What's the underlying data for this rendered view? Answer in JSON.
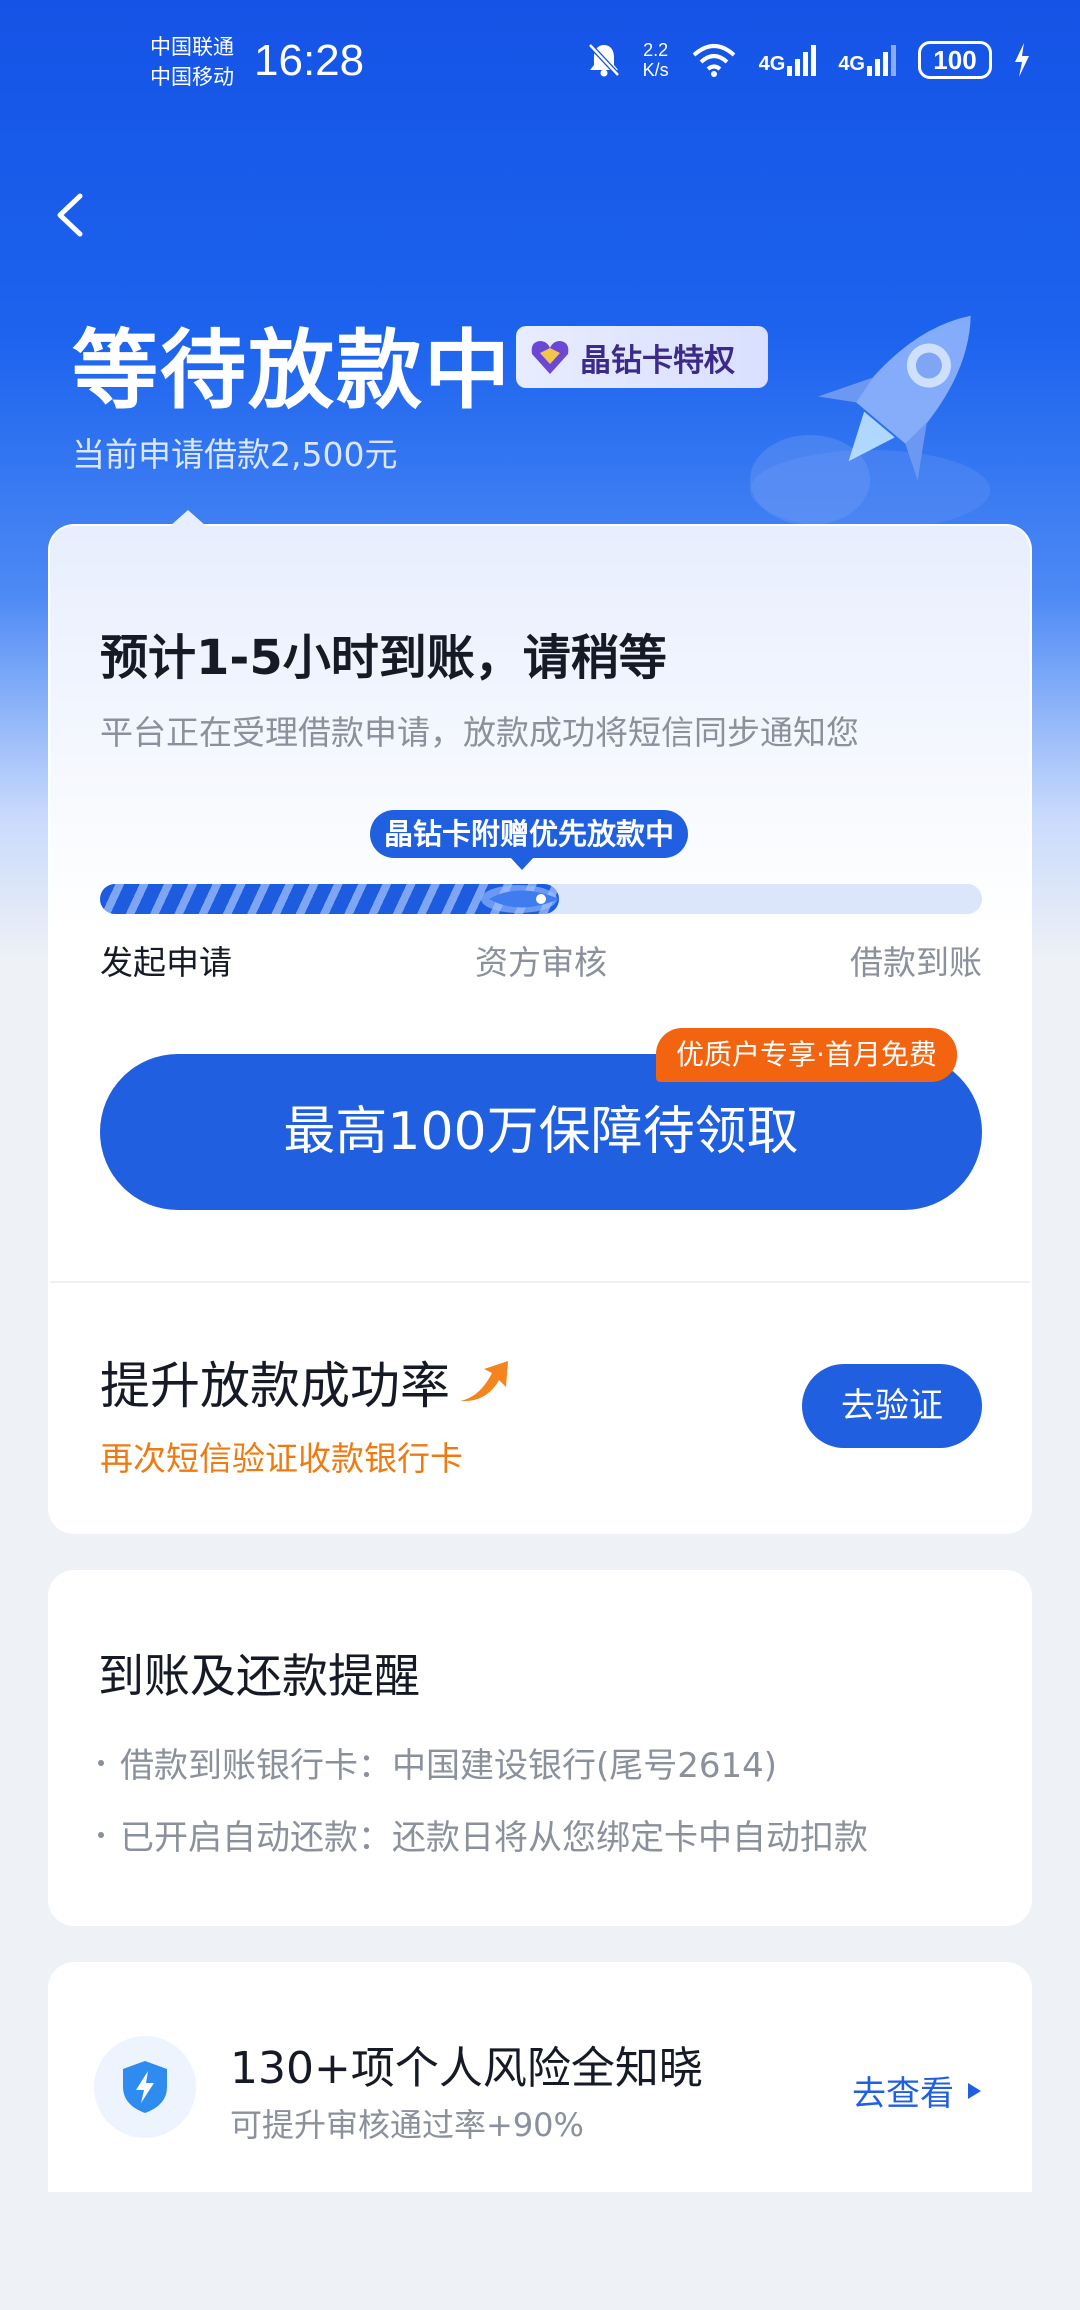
{
  "status_bar": {
    "carrier_1": "中国联通",
    "carrier_2": "中国移动",
    "time": "16:28",
    "net_speed_value": "2.2",
    "net_speed_unit": "K/s",
    "sig1_label": "4G",
    "sig2_label": "4G",
    "battery": "100"
  },
  "header": {
    "title": "等待放款中",
    "badge_label": "晶钻卡特权",
    "subtitle": "当前申请借款2,500元"
  },
  "progress_card": {
    "eta_title": "预计1-5小时到账，请稍等",
    "eta_desc": "平台正在受理借款申请，放款成功将短信同步通知您",
    "tooltip": "晶钻卡附赠优先放款中",
    "progress": 0.52,
    "steps": [
      "发起申请",
      "资方审核",
      "借款到账"
    ],
    "cta_label": "最高100万保障待领取",
    "promo_label": "优质户专享·首月免费",
    "boost_title": "提升放款成功率",
    "boost_desc": "再次短信验证收款银行卡",
    "verify_label": "去验证"
  },
  "reminder_card": {
    "title": "到账及还款提醒",
    "items": [
      "借款到账银行卡：中国建设银行(尾号2614)",
      "已开启自动还款：还款日将从您绑定卡中自动扣款"
    ]
  },
  "risk_card": {
    "title": "130+项个人风险全知晓",
    "desc": "可提升审核通过率+90%",
    "link_label": "去查看"
  },
  "colors": {
    "primary": "#1f5fe0",
    "accent_orange": "#f2640f",
    "muted_text": "#8a909c"
  }
}
